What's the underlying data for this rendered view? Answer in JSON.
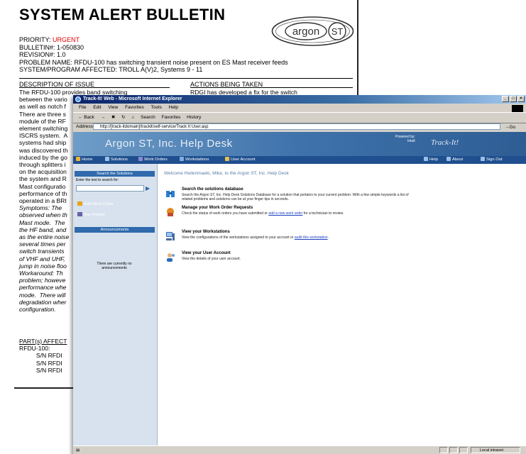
{
  "bulletin": {
    "title": "SYSTEM ALERT BULLETIN",
    "logo_left": "argon",
    "logo_right": "ST",
    "priority_label": "PRIORITY:",
    "priority_value": "URGENT",
    "bulletin_line": "BULLETIN#:  1-050830",
    "revision_line": "REVISION#:  1.0",
    "problem_line": "PROBLEM NAME:  RFDU-100 has switching transient noise present on ES Mast receiver feeds",
    "system_line": "SYSTEM/PROGRAM AFFECTED:  TROLL A(V)2, Systems 9 - 11",
    "desc_heading": "DESCRIPTION OF ISSUE",
    "actions_heading": "ACTIONS BEING TAKEN",
    "desc_text": "The RFDU-100 provides band switching\nbetween the vario\nas well as notch f\nThere are three s\nmodule of the RF\nelement switching\nISCRS system.  A\nsystems had ship\nwas discovered th\ninduced by the go\nthrough splitters i\non the acquisition\nthe system and R\nMast configuratio\nperformance of th\noperated in a BRI",
    "symptoms_text": "Symptoms: The\nobserved when th\nMast mode.  The\nthe HF band, and\nas the entire noise\nseveral times per\nswitch transients\nof VHF and UHF,\njump in noise floo",
    "workaround_text": "Workaround: Th\nproblem; howeve\nperformance whe\nmode.  There will\ndegradation wher\nconfiguration.",
    "actions_text": "RDGI has developed a fix for the switch",
    "parts_heading": "PART(s) AFFECT",
    "parts_text": "RFDU-100:\n          S/N RFDI\n          S/N RFDI\n          S/N RFDI"
  },
  "browser": {
    "title": "Track-It! Web - Microsoft Internet Explorer",
    "menu": [
      "File",
      "Edit",
      "View",
      "Favorites",
      "Tools",
      "Help"
    ],
    "toolbar": [
      "← Back",
      "→",
      "✖",
      "↻",
      "⌂",
      "Search",
      "Favorites",
      "History"
    ],
    "address_label": "Address",
    "address_value": "http://[track-itdomain]/trackit/self-service/Track It User.asp",
    "go_label": "→Go",
    "status_zone": "Local intranet",
    "helpdesk": {
      "title": "Argon ST, Inc. Help Desk",
      "powered_by": "Powered by:",
      "powered_brand": "Intuit",
      "brand": "Track-It!",
      "nav": [
        "Home",
        "Solutions",
        "Work Orders",
        "Workstations",
        "User Account",
        "Help",
        "About",
        "Sign Out"
      ],
      "sidebar_search_head": "Search the Solutions",
      "sidebar_search_hint": "Enter the text to search for:",
      "sidebar_links": [
        "Add Work Order",
        "Run Report"
      ],
      "announcements_head": "Announcements",
      "announcements_text": "There are currently no announcements",
      "welcome": "Welcome Heilenmaeki, Mike, to the Argon ST, Inc. Help Desk",
      "items": [
        {
          "title": "Search the solutions database",
          "desc1": "Search the Argon ST, Inc. Help Desk Solutions Database for a solution that pertains to your current problem. With a few simple keywords a list of",
          "desc2": "related problems and solutions can be at your finger tips in seconds.",
          "link": ""
        },
        {
          "title": "Manage your Work Order Requests",
          "desc1": "Check the status of work orders you have submitted or",
          "link": "add a new work order",
          "desc2": "for a technician to review."
        },
        {
          "title": "View your Workstations",
          "desc1": "View the configurations of the workstations assigned to your account or",
          "link": "audit this workstation",
          "desc2": "."
        },
        {
          "title": "View your User Account",
          "desc1": "View the details of your user account.",
          "link": "",
          "desc2": ""
        }
      ]
    }
  }
}
